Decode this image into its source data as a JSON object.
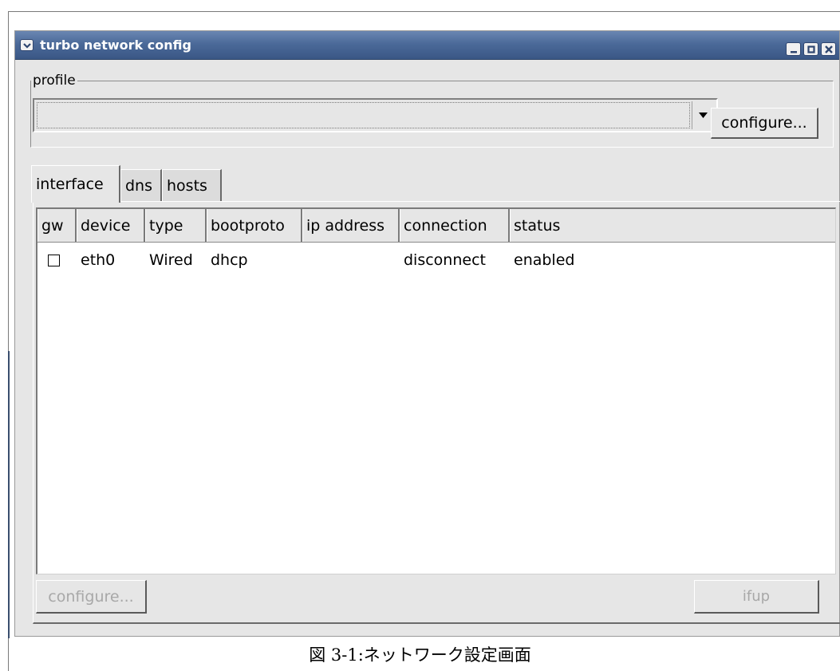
{
  "window": {
    "title": "turbo network config"
  },
  "profile": {
    "label": "profile",
    "value": "",
    "configure_label": "configure..."
  },
  "tabs": [
    {
      "label": "interface",
      "active": true
    },
    {
      "label": "dns",
      "active": false
    },
    {
      "label": "hosts",
      "active": false
    }
  ],
  "table": {
    "columns": [
      "gw",
      "device",
      "type",
      "bootproto",
      "ip address",
      "connection",
      "status"
    ],
    "rows": [
      {
        "gw_checked": false,
        "device": "eth0",
        "type": "Wired",
        "bootproto": "dhcp",
        "ip_address": "",
        "connection": "disconnect",
        "status": "enabled"
      }
    ]
  },
  "bottom": {
    "configure_label": "configure...",
    "ifup_label": "ifup"
  },
  "caption": "図 3-1:ネットワーク設定画面",
  "colors": {
    "titlebar": "#4b6a99",
    "window_bg": "#e6e6e6",
    "title_text": "#ffffff"
  },
  "icons": [
    "menu-chevron-icon",
    "minimize-icon",
    "maximize-icon",
    "close-icon",
    "dropdown-arrow-icon",
    "checkbox-icon"
  ]
}
